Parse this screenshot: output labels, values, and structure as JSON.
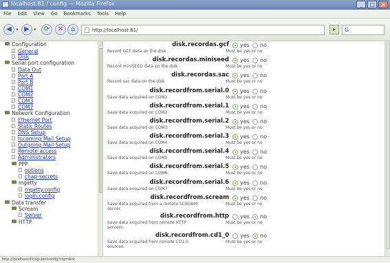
{
  "window": {
    "title": "localhost:81 / config — Mozilla Firefox"
  },
  "menu": [
    "File",
    "Edit",
    "View",
    "Go",
    "Bookmarks",
    "Tools",
    "Help"
  ],
  "toolbar": {
    "url": "http://localhost:81/",
    "search_placeholder": "G"
  },
  "sidebar": {
    "items": [
      {
        "label": "Configuration",
        "type": "folder"
      },
      {
        "label": "General",
        "type": "link"
      },
      {
        "label": "Disk",
        "type": "link"
      },
      {
        "label": "Serial port configuration",
        "type": "folder-doc"
      },
      {
        "label": "Data Out",
        "type": "link"
      },
      {
        "label": "Port A",
        "type": "link"
      },
      {
        "label": "Port B",
        "type": "link"
      },
      {
        "label": "COM1",
        "type": "link"
      },
      {
        "label": "COM2",
        "type": "link"
      },
      {
        "label": "COM3",
        "type": "link"
      },
      {
        "label": "COM7",
        "type": "link"
      },
      {
        "label": "Network Configuration",
        "type": "folder"
      },
      {
        "label": "Ethernet Port",
        "type": "link"
      },
      {
        "label": "Static Routes",
        "type": "link"
      },
      {
        "label": "DNS Setup",
        "type": "link"
      },
      {
        "label": "Incoming Mail Setup",
        "type": "link"
      },
      {
        "label": "Outgoing Mail Setup",
        "type": "link"
      },
      {
        "label": "Remote access",
        "type": "link"
      },
      {
        "label": "Administrators",
        "type": "link"
      },
      {
        "label": "PPP",
        "type": "folder"
      },
      {
        "label": "options",
        "type": "link"
      },
      {
        "label": "chap-secrets",
        "type": "link"
      },
      {
        "label": "mgetty",
        "type": "folder"
      },
      {
        "label": "mgetty.config",
        "type": "link"
      },
      {
        "label": "login.config",
        "type": "link"
      },
      {
        "label": "Data transfer",
        "type": "folder"
      },
      {
        "label": "Scream",
        "type": "folder"
      },
      {
        "label": "Server",
        "type": "link"
      },
      {
        "label": "HTTP",
        "type": "folder"
      }
    ]
  },
  "content": {
    "yes_label": "yes",
    "no_label": "no",
    "must_text": "Must be yes or no",
    "rows": [
      {
        "name": "disk.recordas.gcf",
        "desc": "Record GCF data on the disk",
        "value": "yes"
      },
      {
        "name": "disk.recordas.miniseed",
        "desc": "Record miniSEED data on the disk",
        "value": "yes"
      },
      {
        "name": "disk.recordas.sac",
        "desc": "Record sac data on the disk",
        "value": "yes"
      },
      {
        "name": "disk.recordfrom.serial.0",
        "desc": "Save data acquired on COM1",
        "value": "yes"
      },
      {
        "name": "disk.recordfrom.serial.1",
        "desc": "Save data acquired on COM2",
        "value": "yes"
      },
      {
        "name": "disk.recordfrom.serial.2",
        "desc": "Save data acquired on COM3",
        "value": "yes"
      },
      {
        "name": "disk.recordfrom.serial.3",
        "desc": "Save data acquired on COM4",
        "value": "yes"
      },
      {
        "name": "disk.recordfrom.serial.4",
        "desc": "Save data acquired on COM5",
        "value": "yes"
      },
      {
        "name": "disk.recordfrom.serial.5",
        "desc": "Save data acquired on COM6",
        "value": "yes"
      },
      {
        "name": "disk.recordfrom.serial.6",
        "desc": "Save data acquired on COM7",
        "value": "yes"
      },
      {
        "name": "disk.recordfrom.scream",
        "desc": "Save data acquired from a remote SCREAM!",
        "desc2": "server.",
        "value": "yes"
      },
      {
        "name": "disk.recordfrom.http",
        "desc": "Save data acquired from remote HTTP",
        "desc2": "servers.",
        "value": "no"
      },
      {
        "name": "disk.recordfrom.cd1_0",
        "desc": "Save data acquired from remote CD1.0",
        "desc2": "sources.",
        "value": "no"
      }
    ]
  },
  "status": {
    "text": "http://localhost:81/cgi-bin/config?cfg=disk"
  }
}
